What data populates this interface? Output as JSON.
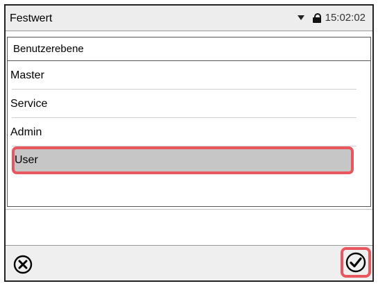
{
  "header": {
    "title": "Festwert",
    "time": "15:02:02",
    "dropdown_icon": "caret-down-icon",
    "lock_icon": "lock-icon"
  },
  "panel": {
    "title": "Benutzerebene",
    "items": [
      {
        "label": "Master",
        "selected": false
      },
      {
        "label": "Service",
        "selected": false
      },
      {
        "label": "Admin",
        "selected": false
      },
      {
        "label": "User",
        "selected": true
      }
    ]
  },
  "footer": {
    "cancel_icon": "cancel-icon",
    "confirm_icon": "confirm-check-icon"
  },
  "colors": {
    "highlight": "#e8575e",
    "selected_bg": "#c6c6c6",
    "bar_bg": "#ededed"
  }
}
